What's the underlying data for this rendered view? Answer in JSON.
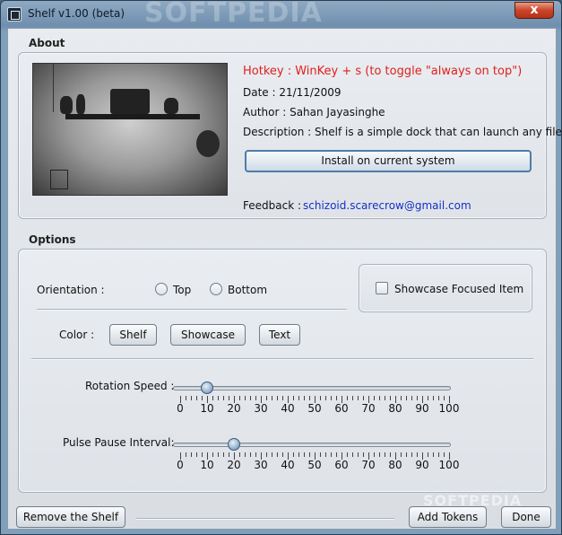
{
  "window": {
    "title": "Shelf v1.00 (beta)",
    "close_label": "x"
  },
  "about": {
    "section_label": "About",
    "hotkey": "Hotkey : WinKey + s  (to toggle \"always on top\")",
    "date": "Date : 21/11/2009",
    "author": "Author : Sahan Jayasinghe",
    "description": "Description : Shelf is a simple dock that can launch any file.",
    "install_label": "Install on current system",
    "feedback_label": "Feedback :",
    "feedback_email": "schizoid.scarecrow@gmail.com"
  },
  "options": {
    "section_label": "Options",
    "orientation_label": "Orientation :",
    "orientation_options": [
      "Top",
      "Bottom"
    ],
    "showcase_focused_label": "Showcase Focused Item",
    "color_label": "Color :",
    "color_buttons": [
      "Shelf",
      "Showcase",
      "Text"
    ],
    "rotation_speed": {
      "label": "Rotation Speed :",
      "value": 10,
      "min": 0,
      "max": 100,
      "ticks": [
        "0",
        "10",
        "20",
        "30",
        "40",
        "50",
        "60",
        "70",
        "80",
        "90",
        "100"
      ]
    },
    "pulse_pause": {
      "label": "Pulse Pause Interval:",
      "value": 20,
      "min": 0,
      "max": 100,
      "ticks": [
        "0",
        "10",
        "20",
        "30",
        "40",
        "50",
        "60",
        "70",
        "80",
        "90",
        "100"
      ]
    }
  },
  "footer": {
    "remove_label": "Remove the Shelf",
    "add_tokens_label": "Add Tokens",
    "done_label": "Done"
  },
  "watermarks": {
    "top": "SOFTPEDIA",
    "bottom": "SOFTPEDIA"
  },
  "colors": {
    "hotkey": "#e0201e",
    "email": "#1530c8",
    "close": "#c8452a"
  }
}
